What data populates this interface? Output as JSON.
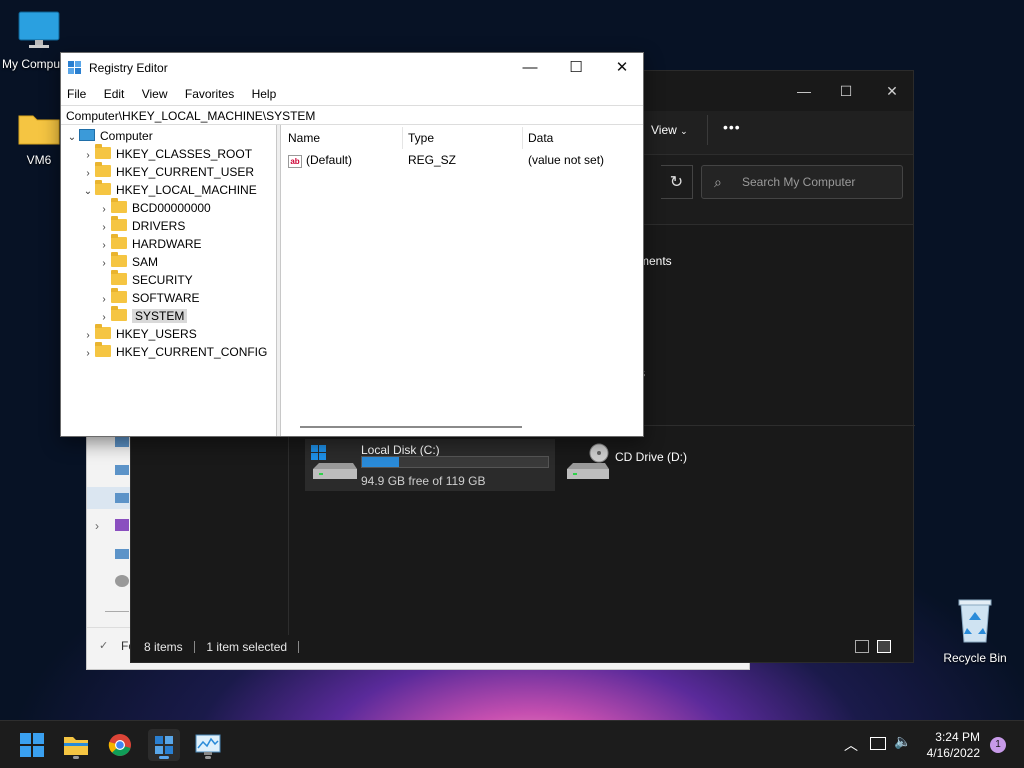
{
  "desktop": {
    "icons": [
      {
        "label": "My Computer"
      },
      {
        "label": "VM6"
      },
      {
        "label": "Recycle Bin"
      }
    ]
  },
  "explorer": {
    "view_label": "View",
    "more_label": "•••",
    "search_placeholder": "Search My Computer",
    "fragment_1": "ments",
    "fragment_2": "s",
    "fragment_3": "Fe",
    "drives": [
      {
        "name": "Local Disk (C:)",
        "free_text": "94.9 GB free of 119 GB",
        "used_fraction": 0.2
      },
      {
        "name": "CD Drive (D:)"
      }
    ],
    "status": {
      "items": "8 items",
      "selected": "1 item selected"
    }
  },
  "regedit": {
    "title": "Registry Editor",
    "menu": [
      "File",
      "Edit",
      "View",
      "Favorites",
      "Help"
    ],
    "address": "Computer\\HKEY_LOCAL_MACHINE\\SYSTEM",
    "tree": {
      "root": "Computer",
      "hives": [
        "HKEY_CLASSES_ROOT",
        "HKEY_CURRENT_USER",
        "HKEY_LOCAL_MACHINE",
        "HKEY_USERS",
        "HKEY_CURRENT_CONFIG"
      ],
      "hklm_children": [
        "BCD00000000",
        "DRIVERS",
        "HARDWARE",
        "SAM",
        "SECURITY",
        "SOFTWARE",
        "SYSTEM"
      ],
      "selected": "SYSTEM"
    },
    "columns": {
      "name": "Name",
      "type": "Type",
      "data": "Data"
    },
    "values": [
      {
        "name": "(Default)",
        "type": "REG_SZ",
        "data": "(value not set)"
      }
    ]
  },
  "taskbar": {
    "time": "3:24 PM",
    "date": "4/16/2022",
    "notification_count": "1"
  },
  "colors": {
    "accent": "#2a8bd9",
    "folder": "#f5c542"
  }
}
